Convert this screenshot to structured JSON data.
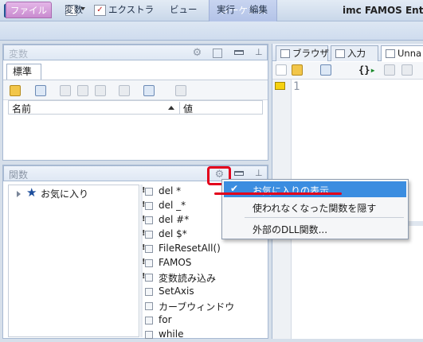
{
  "window": {
    "title": "imc FAMOS Ente",
    "context_tab": "シーケンス",
    "accent_file_tab": "#c98bcf"
  },
  "ribbon": {
    "tabs": [
      "ファイル",
      "変数",
      "エクストラ",
      "ビュー",
      "実行",
      "編集"
    ]
  },
  "variables_panel": {
    "title": "変数",
    "tab": "標準",
    "columns": [
      "名前",
      "値"
    ]
  },
  "functions_panel": {
    "title": "関数",
    "tree_item": "お気に入り",
    "functions": [
      {
        "label": "del *",
        "icon": "bang"
      },
      {
        "label": "del _*",
        "icon": "bang"
      },
      {
        "label": "del #*",
        "icon": "bang"
      },
      {
        "label": "del $*",
        "icon": "bang"
      },
      {
        "label": "FileResetAll()",
        "icon": "bang"
      },
      {
        "label": "FAMOS",
        "icon": "bang"
      },
      {
        "label": "変数読み込み",
        "icon": "bang"
      },
      {
        "label": "SetAxis",
        "icon": "plain"
      },
      {
        "label": "カーブウィンドウ",
        "icon": "plain"
      },
      {
        "label": "for",
        "icon": "plain"
      },
      {
        "label": "while",
        "icon": "plain"
      }
    ]
  },
  "editor": {
    "tabs": [
      "ブラウザ",
      "入力",
      "Unna"
    ],
    "line_number": "1"
  },
  "context_menu": {
    "items": [
      {
        "label": "お気に入りの表示",
        "checked": true,
        "highlighted": true
      },
      {
        "label": "使われなくなった関数を隠す",
        "checked": false
      },
      {
        "label": "外部のDLL関数...",
        "checked": false
      }
    ],
    "highlight_color": "#3b8de0",
    "annotation_color": "#e3001b"
  }
}
